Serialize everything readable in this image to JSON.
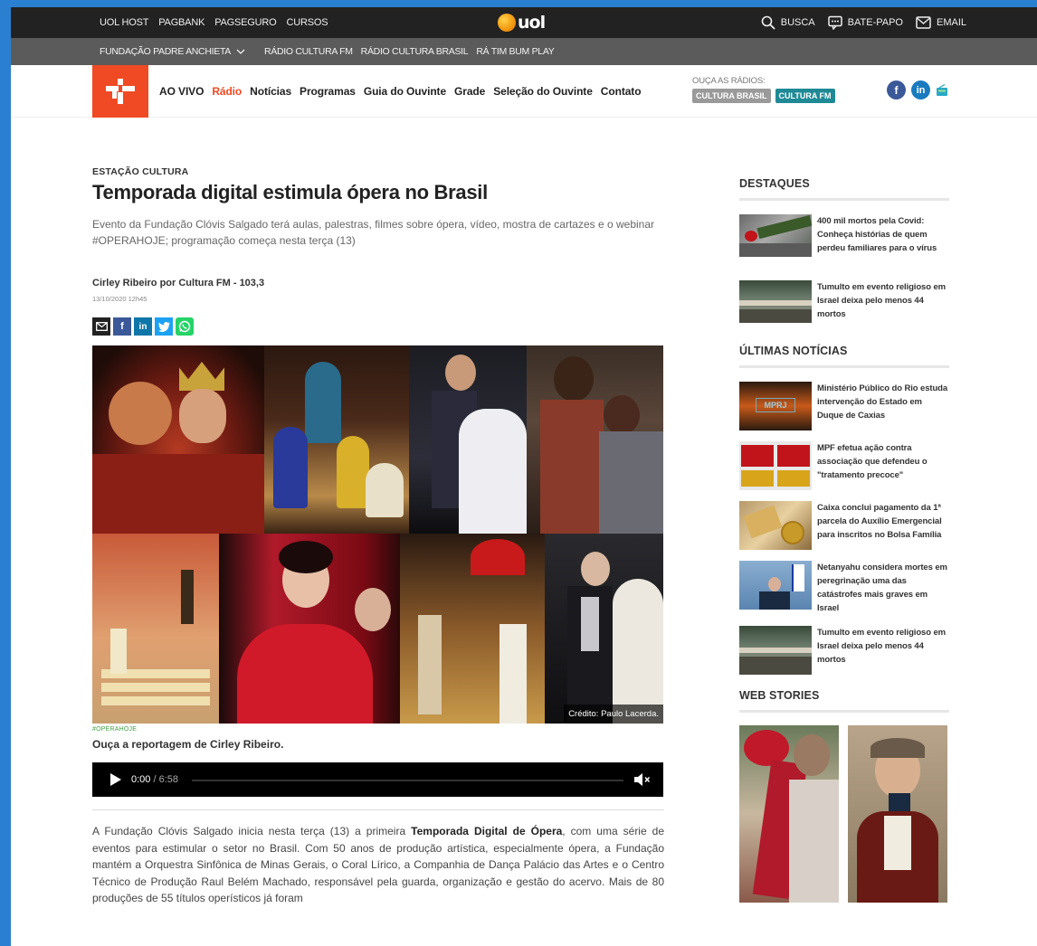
{
  "uol_bar": {
    "links": [
      "UOL HOST",
      "PAGBANK",
      "PAGSEGURO",
      "CURSOS"
    ],
    "logo": "uol",
    "right": [
      {
        "icon": "search-icon",
        "label": "BUSCA"
      },
      {
        "icon": "chat-icon",
        "label": "BATE-PAPO"
      },
      {
        "icon": "mail-icon",
        "label": "EMAIL"
      }
    ]
  },
  "fpa_bar": {
    "first": "FUNDAÇÃO PADRE ANCHIETA",
    "items": [
      "RÁDIO CULTURA FM",
      "RÁDIO CULTURA BRASIL",
      "RÁ TIM BUM PLAY"
    ]
  },
  "nav": {
    "links": [
      "AO VIVO",
      "Rádio",
      "Notícias",
      "Programas",
      "Guia do Ouvinte",
      "Grade",
      "Seleção do Ouvinte",
      "Contato"
    ],
    "active": "Rádio",
    "radios_label": "OUÇA AS RÁDIOS:",
    "radio_brasil": "CULTURA BRASIL",
    "radio_fm": "CULTURA FM",
    "social": [
      "facebook-icon",
      "linkedin-icon",
      "radio-icon"
    ]
  },
  "article": {
    "kicker": "ESTAÇÃO CULTURA",
    "title": "Temporada digital estimula ópera no Brasil",
    "subtitle": "Evento da Fundação Clóvis Salgado terá aulas, palestras, filmes sobre ópera, vídeo, mostra de cartazes e o webinar #OPERAHOJE; programação começa nesta terça (13)",
    "author": "Cirley Ribeiro por Cultura FM - 103,3",
    "date": "13/10/2020 12h45",
    "photo_credit": "Crédito: Paulo Lacerda.",
    "tag": "#OPERAHOJE",
    "listen": "Ouça a reportagem de Cirley Ribeiro.",
    "player": {
      "current": "0:00",
      "sep": " / ",
      "total": "6:58"
    },
    "body_p1": "A Fundação Clóvis Salgado inicia nesta terça (13) a primeira ",
    "body_bold": "Temporada Digital de Ópera",
    "body_p2": ", com uma série de eventos para estimular o setor no Brasil. Com 50 anos de produção artística, especialmente ópera, a Fundação mantém a Orquestra Sinfônica de Minas Gerais, o Coral Lírico, a Companhia de Dança Palácio das Artes e o Centro Técnico de Produção Raul Belém Machado, responsável pela guarda, organização e gestão do acervo. Mais de 80 produções de 55 títulos operísticos já foram"
  },
  "sidebar": {
    "destaques_title": "DESTAQUES",
    "destaques": [
      "400 mil mortos pela Covid: Conheça histórias de quem perdeu familiares para o vírus",
      "Tumulto em evento religioso em Israel deixa pelo menos 44 mortos"
    ],
    "ultimas_title": "ÚLTIMAS NOTÍCIAS",
    "ultimas": [
      "Ministério Público do Rio estuda intervenção do Estado em Duque de Caxias",
      "MPF efetua ação contra associação que defendeu o \"tratamento precoce\"",
      "Caixa conclui pagamento da 1ª parcela do Auxílio Emergencial para inscritos no Bolsa Família",
      "Netanyahu considera mortes em peregrinação uma das catástrofes mais graves em Israel",
      "Tumulto em evento religioso em Israel deixa pelo menos 44 mortos"
    ],
    "web_stories_title": "WEB STORIES"
  }
}
